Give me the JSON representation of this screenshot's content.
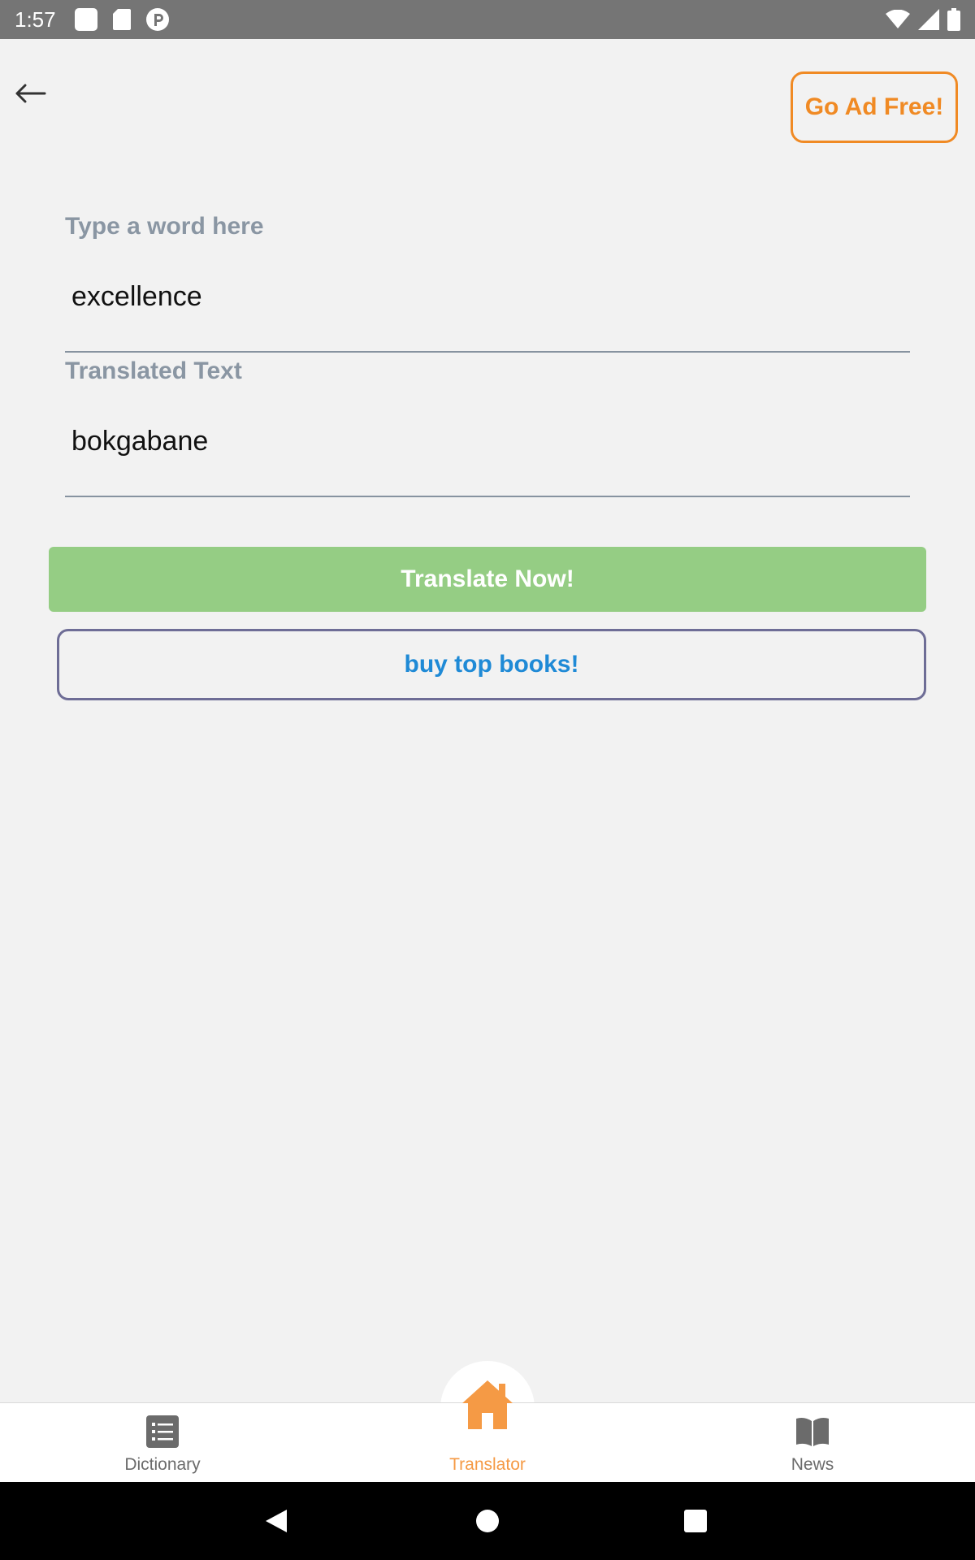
{
  "status_bar": {
    "time": "1:57",
    "left_icons": [
      "square-notification-icon",
      "sd-card-icon",
      "pocket-icon"
    ],
    "right_icons": [
      "wifi-icon",
      "cell-signal-icon",
      "battery-icon"
    ]
  },
  "top_bar": {
    "back_icon": "arrow-left-icon",
    "ad_free_label": "Go Ad Free!"
  },
  "translator": {
    "input_label": "Type a word here",
    "input_value": "excellence",
    "output_label": "Translated Text",
    "output_value": "bokgabane",
    "translate_label": "Translate Now!",
    "books_label": "buy top books!"
  },
  "bottom_nav": {
    "items": [
      {
        "label": "Dictionary",
        "icon": "list-icon",
        "active": false
      },
      {
        "label": "Translator",
        "icon": "home-icon",
        "active": true
      },
      {
        "label": "News",
        "icon": "book-open-icon",
        "active": false
      }
    ]
  },
  "colors": {
    "accent_orange": "#f08a24",
    "translate_green": "#95cd84",
    "link_blue": "#1f8ad6",
    "label_gray": "#8a96a3"
  }
}
